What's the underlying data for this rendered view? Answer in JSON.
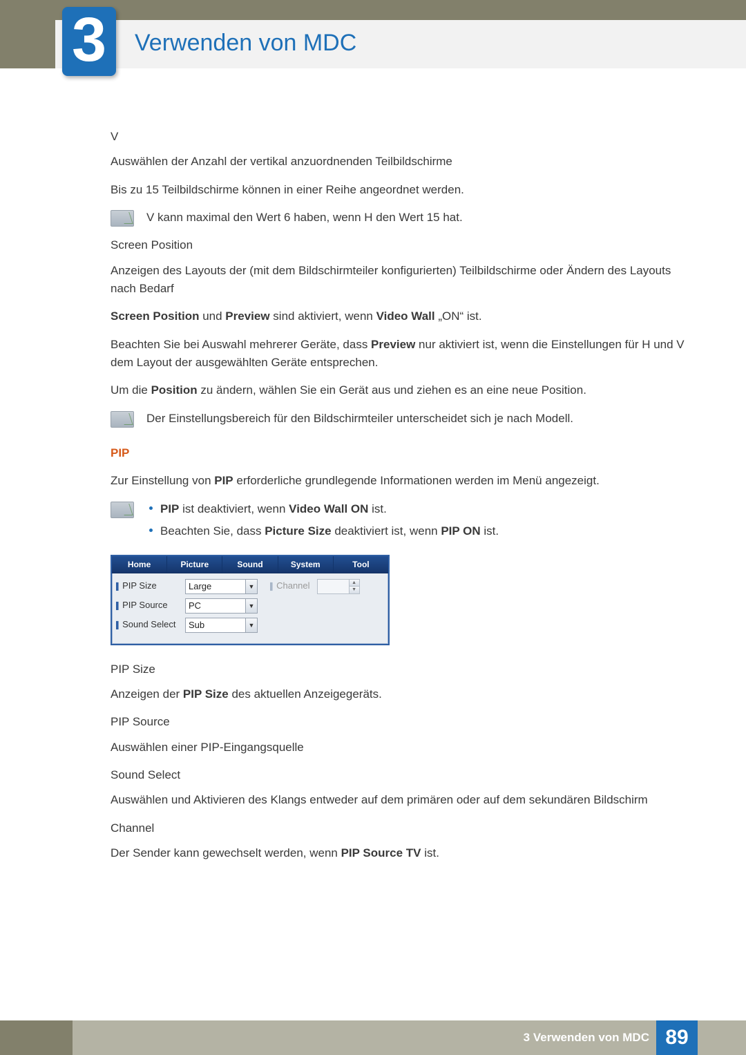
{
  "header": {
    "chapter_number": "3",
    "chapter_title": "Verwenden von MDC"
  },
  "body": {
    "v_heading": "V",
    "v_p1": "Auswählen der Anzahl der vertikal anzuordnenden Teilbildschirme",
    "v_p2": "Bis zu 15 Teilbildschirme können in einer Reihe angeordnet werden.",
    "v_note": "V kann maximal den Wert 6 haben, wenn H den Wert 15 hat.",
    "sp_heading": "Screen Position",
    "sp_p1": "Anzeigen des Layouts der (mit dem Bildschirmteiler konfigurierten) Teilbildschirme oder Ändern des Layouts nach Bedarf",
    "sp_p2_pre": "Screen Position",
    "sp_p2_mid1": " und ",
    "sp_p2_b2": "Preview",
    "sp_p2_mid2": " sind aktiviert, wenn ",
    "sp_p2_b3": "Video Wall",
    "sp_p2_post": " „ON“ ist.",
    "sp_p3_pre": "Beachten Sie bei Auswahl mehrerer Geräte, dass ",
    "sp_p3_b1": "Preview",
    "sp_p3_post": " nur aktiviert ist, wenn die Einstellungen für H und V dem Layout der ausgewählten Geräte entsprechen.",
    "sp_p4_pre": "Um die ",
    "sp_p4_b1": "Position",
    "sp_p4_post": " zu ändern, wählen Sie ein Gerät aus und ziehen es an eine neue Position.",
    "sp_note": "Der Einstellungsbereich für den Bildschirmteiler unterscheidet sich je nach Modell.",
    "pip_heading": "PIP",
    "pip_intro_pre": "Zur Einstellung von ",
    "pip_intro_b": "PIP",
    "pip_intro_post": " erforderliche grundlegende Informationen werden im Menü angezeigt.",
    "pip_note1_b1": "PIP",
    "pip_note1_mid": " ist deaktiviert, wenn ",
    "pip_note1_b2": "Video Wall ON",
    "pip_note1_post": " ist.",
    "pip_note2_pre": "Beachten Sie, dass ",
    "pip_note2_b1": "Picture Size",
    "pip_note2_mid": " deaktiviert ist, wenn ",
    "pip_note2_b2": "PIP ON",
    "pip_note2_post": " ist.",
    "pip_size_h": "PIP Size",
    "pip_size_p_pre": "Anzeigen der ",
    "pip_size_p_b": "PIP Size",
    "pip_size_p_post": " des aktuellen Anzeigegeräts.",
    "pip_source_h": "PIP Source",
    "pip_source_p": "Auswählen einer PIP-Eingangsquelle",
    "sound_h": "Sound Select",
    "sound_p": "Auswählen und Aktivieren des Klangs entweder auf dem primären oder auf dem sekundären Bildschirm",
    "channel_h": "Channel",
    "channel_p_pre": "Der Sender kann gewechselt werden, wenn ",
    "channel_p_b": "PIP Source TV",
    "channel_p_post": " ist."
  },
  "panel": {
    "tabs": [
      "Home",
      "Picture",
      "Sound",
      "System",
      "Tool"
    ],
    "rows": {
      "pip_size_label": "PIP Size",
      "pip_size_value": "Large",
      "pip_source_label": "PIP Source",
      "pip_source_value": "PC",
      "sound_select_label": "Sound Select",
      "sound_select_value": "Sub",
      "channel_label": "Channel"
    }
  },
  "footer": {
    "text": "3 Verwenden von MDC",
    "page": "89"
  }
}
